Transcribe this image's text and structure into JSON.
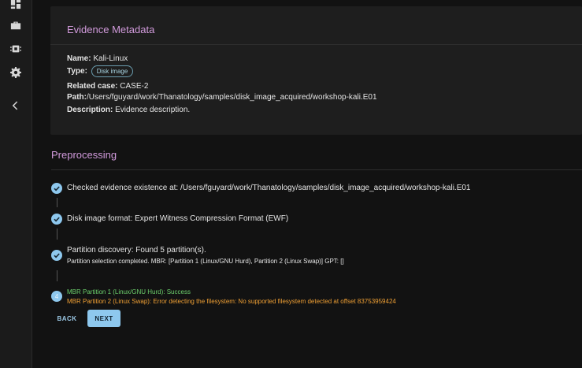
{
  "sidebar": {
    "icons": [
      "dashboard-icon",
      "briefcase-icon",
      "chip-icon",
      "gear-icon",
      "chevron-left-icon"
    ]
  },
  "evidence": {
    "title": "Evidence Metadata",
    "name_label": "Name:",
    "name_value": "Kali-Linux",
    "type_label": "Type:",
    "type_value": "Disk image",
    "case_label": "Related case:",
    "case_value": "CASE-2",
    "path_label": "Path:",
    "path_value": "/Users/fguyard/work/Thanatology/samples/disk_image_acquired/workshop-kali.E01",
    "desc_label": "Description:",
    "desc_value": "Evidence description."
  },
  "preprocessing": {
    "title": "Preprocessing",
    "steps": [
      {
        "text": "Checked evidence existence at: /Users/fguyard/work/Thanatology/samples/disk_image_acquired/workshop-kali.E01"
      },
      {
        "text": "Disk image format: Expert Witness Compression Format (EWF)"
      },
      {
        "text": "Partition discovery: Found 5 partition(s).",
        "sub": "Partition selection completed. MBR: [Partition 1 (Linux/GNU Hurd), Partition 2 (Linux Swap)] GPT: []"
      },
      {
        "number": "4",
        "success": "MBR Partition 1 (Linux/GNU Hurd): Success",
        "error": "MBR Partition 2 (Linux Swap): Error detecting the filesystem: No supported filesystem detected at offset 83753959424"
      }
    ]
  },
  "buttons": {
    "back": "BACK",
    "next": "NEXT"
  },
  "colors": {
    "accent": "#8ec8ee",
    "title": "#d29bdc",
    "success": "#6ccf6c",
    "error": "#f0a034"
  }
}
